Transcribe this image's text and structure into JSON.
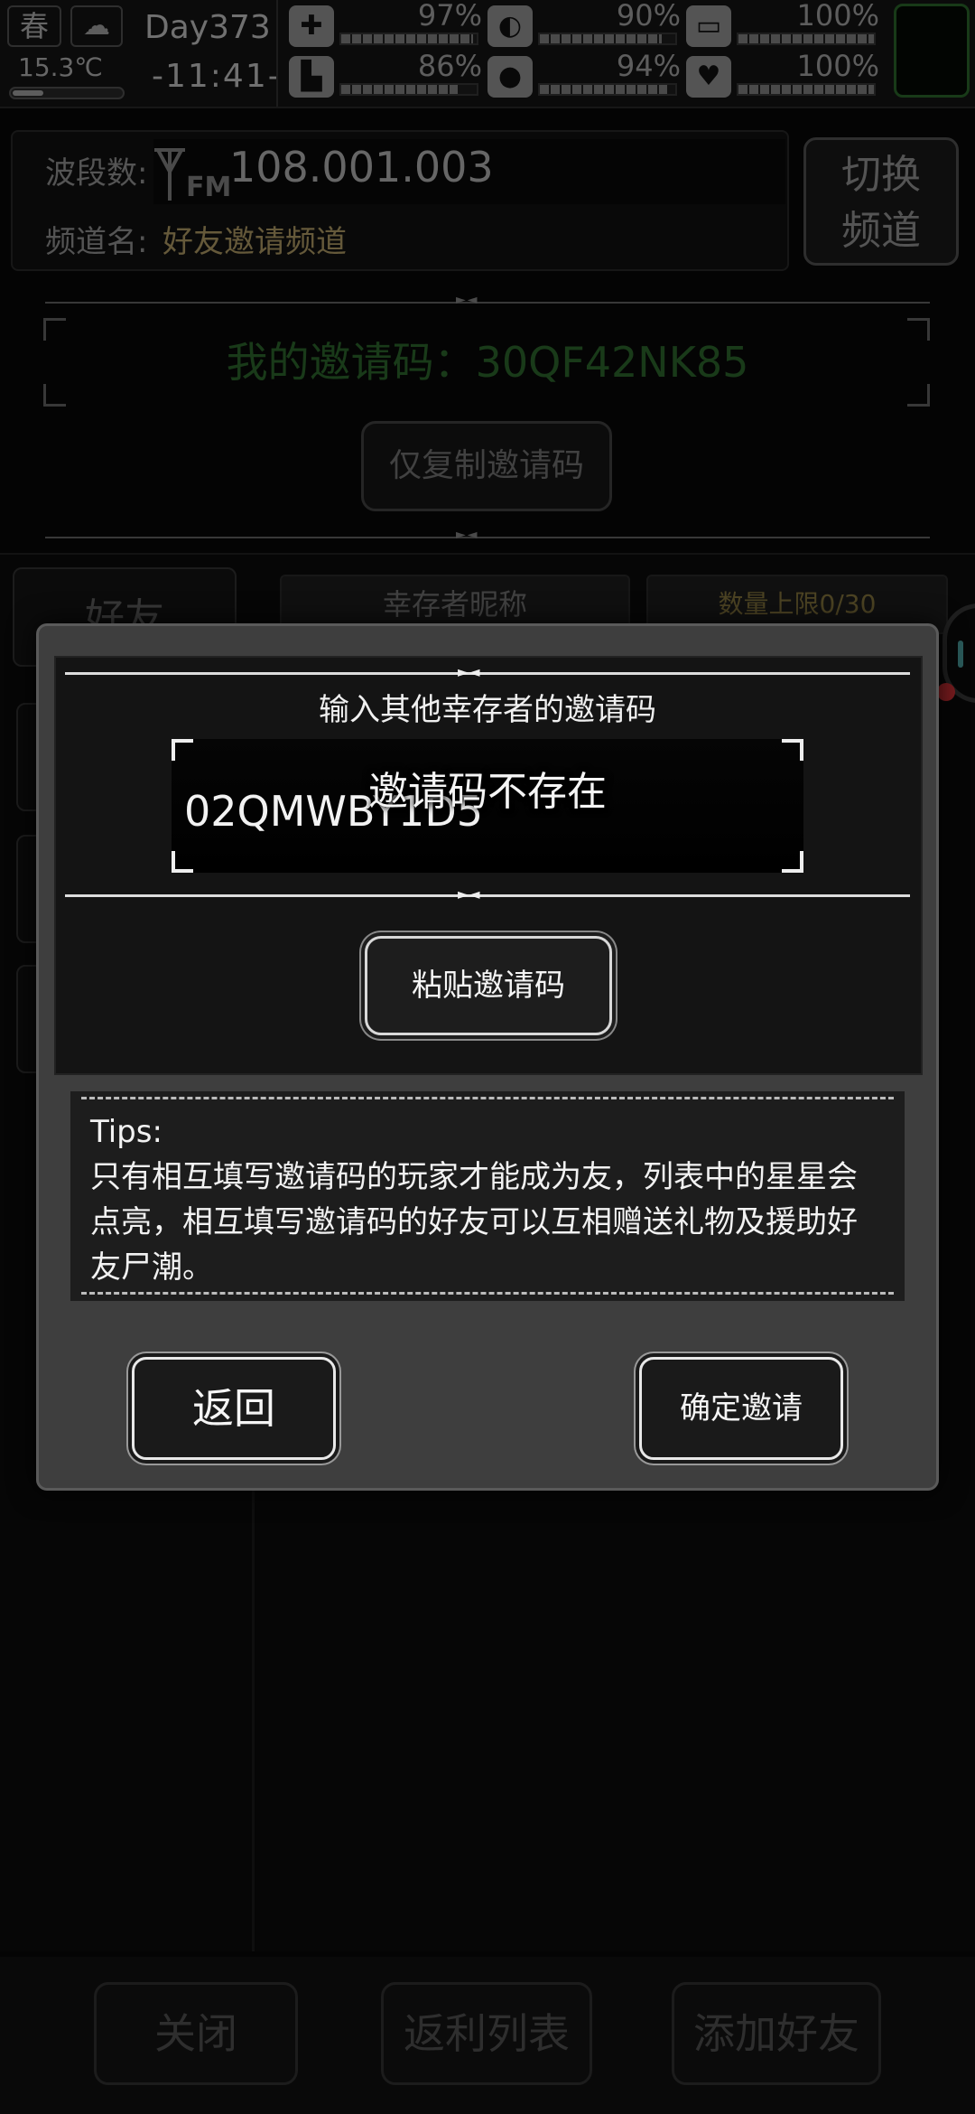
{
  "status": {
    "season": "春",
    "temperature": "15.3℃",
    "day": "Day373",
    "clock": "-11:41-",
    "stats": [
      {
        "name": "medical",
        "icon": "medkit-icon",
        "glyph": "✚",
        "value": "97%",
        "level": 0.97
      },
      {
        "name": "hunger",
        "icon": "stomach-icon",
        "glyph": "◐",
        "value": "90%",
        "level": 0.9
      },
      {
        "name": "pill",
        "icon": "pill-icon",
        "glyph": "▭",
        "value": "100%",
        "level": 1.0
      },
      {
        "name": "stamina",
        "icon": "boot-icon",
        "glyph": "▙",
        "value": "86%",
        "level": 0.86
      },
      {
        "name": "thirst",
        "icon": "water-drop-icon",
        "glyph": "●",
        "value": "94%",
        "level": 0.94
      },
      {
        "name": "health",
        "icon": "heart-icon",
        "glyph": "♥",
        "value": "100%",
        "level": 1.0
      }
    ]
  },
  "radio": {
    "band_label": "波段数:",
    "fm_label": "FM",
    "frequency": "108.001.003",
    "channel_label": "频道名:",
    "channel_name": "好友邀请频道",
    "switch_line1": "切换",
    "switch_line2": "频道"
  },
  "invite": {
    "my_code_text": "我的邀请码：30QF42NK85",
    "copy_button": "仅复制邀请码"
  },
  "list": {
    "tab_friends": "好友",
    "col_nickname": "幸存者昵称",
    "col_limit": "数量上限0/30"
  },
  "bottom": {
    "close": "关闭",
    "rebate": "返利列表",
    "add_friend": "添加好友"
  },
  "dialog": {
    "input_title": "输入其他幸存者的邀请码",
    "input_value": "02QMWBY1D5",
    "error_toast": "邀请码不存在",
    "paste_button": "粘贴邀请码",
    "tips_title": "Tips:",
    "tips_body": "只有相互填写邀请码的玩家才能成为友，列表中的星星会点亮，相互填写邀请码的好友可以互相赠送礼物及援助好友尸潮。",
    "back_button": "返回",
    "confirm_button": "确定邀请"
  }
}
